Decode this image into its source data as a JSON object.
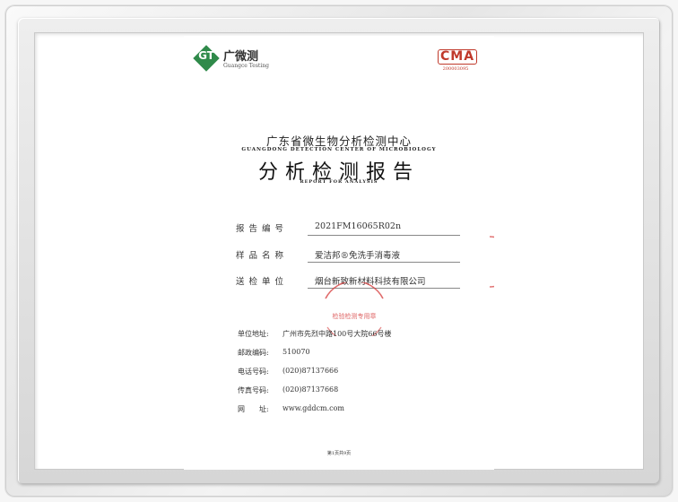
{
  "header": {
    "logo_mark": "GT",
    "logo_cn": "广微测",
    "logo_en": "Guangce Testing",
    "cma_mark": "CMA",
    "cma_sub": "200003095"
  },
  "org": {
    "name_cn": "广东省微生物分析检测中心",
    "name_en": "GUANGDONG DETECTION CENTER OF MICROBIOLOGY"
  },
  "title": {
    "cn": "分析检测报告",
    "en": "REPORT FOR ANALYSIS"
  },
  "fields": [
    {
      "label": "报告编号",
      "value": "2021FM16065R02n"
    },
    {
      "label": "样品名称",
      "value": "爱洁邦®免洗手消毒液"
    },
    {
      "label": "送检单位",
      "value": "烟台新致新材料科技有限公司"
    }
  ],
  "stamp": {
    "text": "检验检测专用章"
  },
  "contact": [
    {
      "label": "单位地址:",
      "value": "广州市先烈中路100号大院66号楼"
    },
    {
      "label": "邮政编码:",
      "value": "510070"
    },
    {
      "label": "电话号码:",
      "value": "(020)87137666"
    },
    {
      "label": "传真号码:",
      "value": "(020)87137668"
    },
    {
      "label": "网　　址:",
      "value": "www.gddcm.com"
    }
  ],
  "footer": {
    "page": "第1页共9页"
  },
  "colors": {
    "brand_green": "#2f8a4a",
    "stamp_red": "#d63a3a"
  }
}
